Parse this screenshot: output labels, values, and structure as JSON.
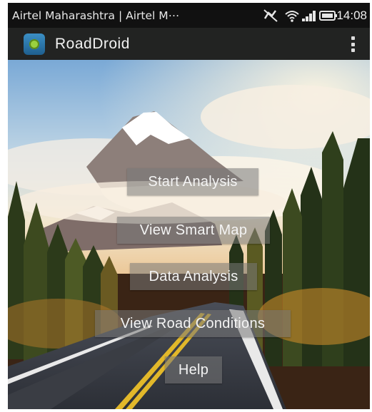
{
  "statusbar": {
    "carrier": "Airtel Maharashtra | Airtel M⋯",
    "time": "14:08",
    "icons": [
      "notification-off-icon",
      "wifi-icon",
      "signal-icon",
      "signal-icon",
      "battery-icon"
    ]
  },
  "appbar": {
    "title": "RoadDroid",
    "icon": "app-logo-icon",
    "menu_icon": "overflow-menu-icon"
  },
  "menu": {
    "start_analysis": "Start Analysis",
    "view_smart_map": "View Smart Map",
    "data_analysis": "Data Analysis",
    "view_road_conditions": "View Road Conditions",
    "help": "Help"
  }
}
